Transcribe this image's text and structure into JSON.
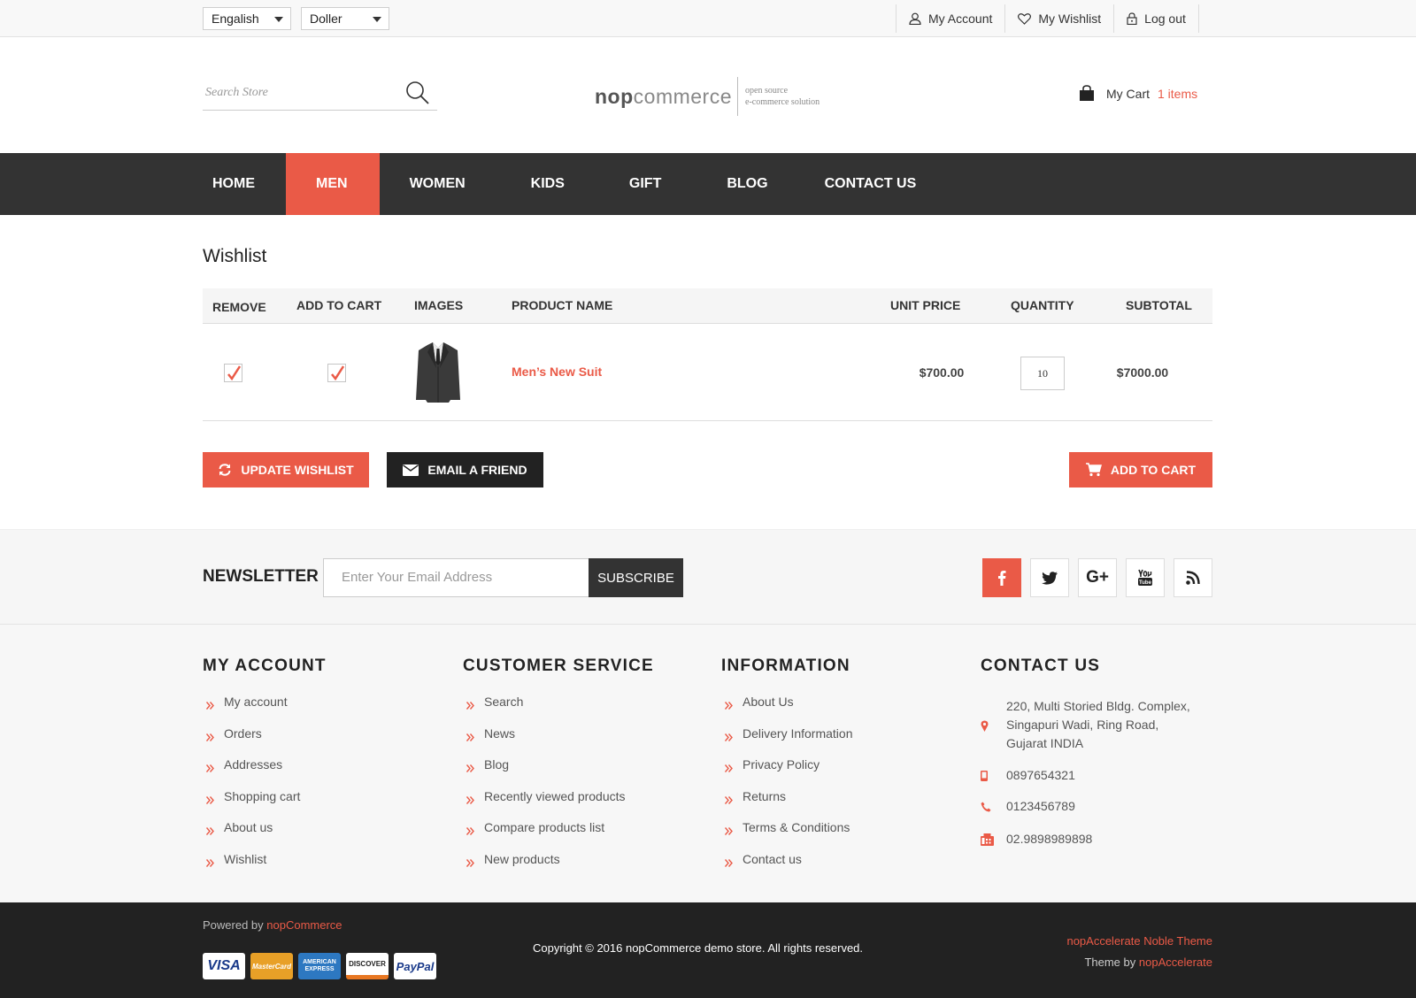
{
  "topbar": {
    "language": "Engalish",
    "currency": "Doller",
    "my_account": "My Account",
    "my_wishlist": "My Wishlist",
    "logout": "Log out"
  },
  "header": {
    "search_placeholder": "Search Store",
    "logo_nop": "nop",
    "logo_commerce": "commerce",
    "logo_tag1": "open source",
    "logo_tag2": "e-commerce solution",
    "cart_label": "My Cart",
    "cart_count": "1  items"
  },
  "nav": [
    "HOME",
    "MEN",
    "WOMEN",
    "KIDS",
    "GIFT",
    "BLOG",
    "CONTACT US"
  ],
  "nav_active": "MEN",
  "wishlist": {
    "title": "Wishlist",
    "columns": {
      "remove": "REMOVE",
      "add_to_cart": "ADD TO CART",
      "images": "IMAGES",
      "product_name": "PRODUCT NAME",
      "unit_price": "UNIT PRICE",
      "quantity": "QUANTITY",
      "subtotal": "SUBTOTAL"
    },
    "item": {
      "name": "Men’s New Suit",
      "unit_price": "$700.00",
      "quantity": "10",
      "subtotal": "$7000.00",
      "remove_checked": true,
      "add_checked": true
    },
    "buttons": {
      "update": "UPDATE WISHLIST",
      "email": "EMAIL A FRIEND",
      "add_to_cart": "ADD TO CART"
    }
  },
  "newsletter": {
    "label": "NEWSLETTER",
    "placeholder": "Enter Your Email Address",
    "subscribe": "SUBSCRIBE"
  },
  "footer": {
    "my_account": {
      "title": "MY ACCOUNT",
      "links": [
        "My account",
        "Orders",
        "Addresses",
        "Shopping cart",
        "About us",
        "Wishlist"
      ]
    },
    "customer_service": {
      "title": "CUSTOMER SERVICE",
      "links": [
        "Search",
        "News",
        "Blog",
        "Recently viewed products",
        "Compare products list",
        "New products"
      ]
    },
    "information": {
      "title": "INFORMATION",
      "links": [
        "About Us",
        "Delivery Information",
        "Privacy Policy",
        "Returns",
        "Terms & Conditions",
        "Contact us"
      ]
    },
    "contact": {
      "title": "CONTACT US",
      "address1": "220, Multi Storied Bldg. Complex,",
      "address2": "Singapuri Wadi, Ring Road,",
      "address3": "Gujarat INDIA",
      "mobile": "0897654321",
      "phone": "0123456789",
      "fax": "02.9898989898"
    }
  },
  "bottom": {
    "powered_by": "Powered by",
    "powered_link": "nopCommerce",
    "copyright": "Copyright © 2016 nopCommerce demo store. All rights reserved.",
    "theme_name": "nopAccelerate Noble Theme",
    "theme_by": "Theme by",
    "theme_link": "nopAccelerate",
    "cards": [
      "VISA",
      "MasterCard",
      "AMERICAN EXPRESS",
      "DISCOVER",
      "PayPal"
    ]
  },
  "colors": {
    "accent": "#ea5a47",
    "dark": "#333333"
  }
}
